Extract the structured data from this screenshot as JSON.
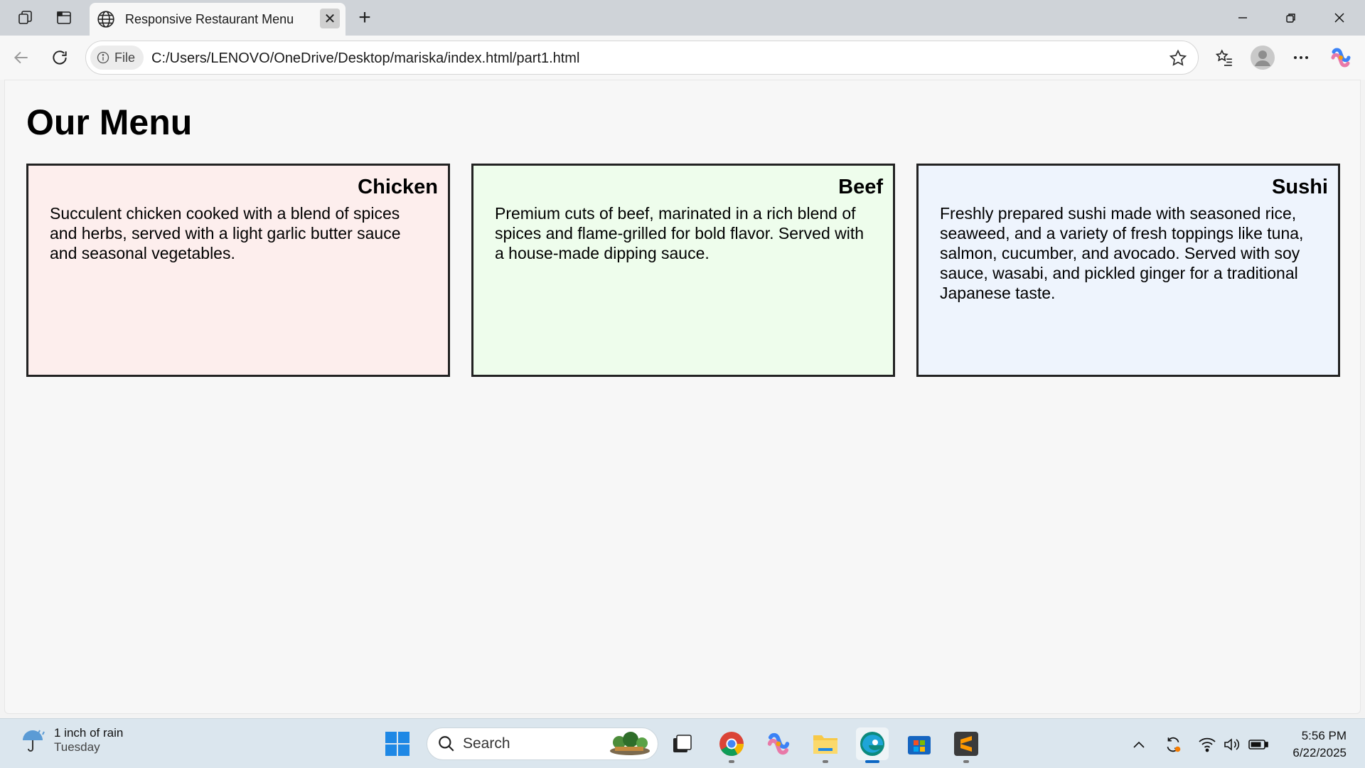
{
  "browser": {
    "tab_title": "Responsive Restaurant Menu",
    "file_chip": "File",
    "url": "C:/Users/LENOVO/OneDrive/Desktop/mariska/index.html/part1.html"
  },
  "page": {
    "title": "Our Menu",
    "cards": [
      {
        "name": "Chicken",
        "description": "Succulent chicken cooked with a blend of spices and herbs, served with a light garlic butter sauce and seasonal vegetables.",
        "bg": "#fdeeed"
      },
      {
        "name": "Beef",
        "description": "Premium cuts of beef, marinated in a rich blend of spices and flame-grilled for bold flavor. Served with a house-made dipping sauce.",
        "bg": "#eefdec"
      },
      {
        "name": "Sushi",
        "description": "Freshly prepared sushi made with seasoned rice, seaweed, and a variety of fresh toppings like tuna, salmon, cucumber, and avocado. Served with soy sauce, wasabi, and pickled ginger for a traditional Japanese taste.",
        "bg": "#eef4fd"
      }
    ]
  },
  "taskbar": {
    "weather_line1": "1 inch of rain",
    "weather_line2": "Tuesday",
    "search_label": "Search",
    "time": "5:56 PM",
    "date": "6/22/2025"
  }
}
